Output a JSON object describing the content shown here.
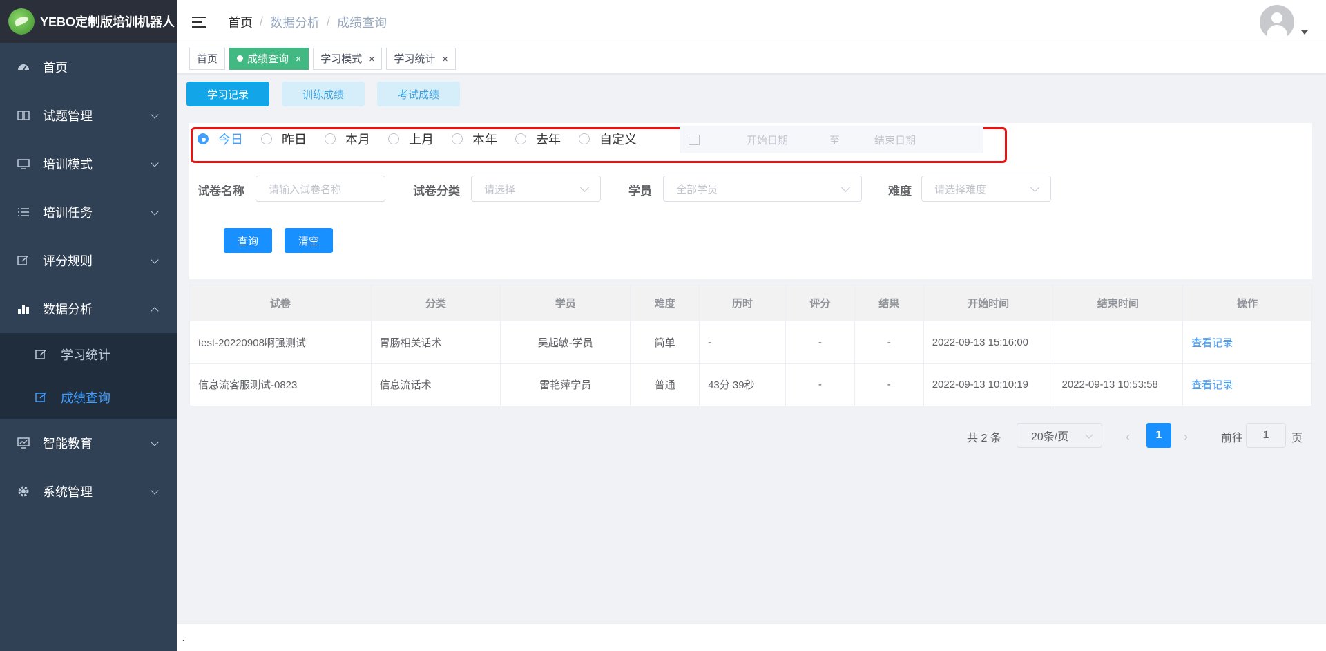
{
  "app": {
    "title": "YEBO定制版培训机器人"
  },
  "sidebar": {
    "items": [
      {
        "label": "首页",
        "icon": "dashboard-icon"
      },
      {
        "label": "试题管理",
        "icon": "book-icon"
      },
      {
        "label": "培训模式",
        "icon": "monitor-icon"
      },
      {
        "label": "培训任务",
        "icon": "list-icon"
      },
      {
        "label": "评分规则",
        "icon": "edit-icon"
      },
      {
        "label": "数据分析",
        "icon": "bar-chart-icon"
      },
      {
        "label": "智能教育",
        "icon": "chart-screen-icon"
      },
      {
        "label": "系统管理",
        "icon": "gear-icon"
      }
    ],
    "sub_items": [
      {
        "label": "学习统计",
        "icon": "edit-icon"
      },
      {
        "label": "成绩查询",
        "icon": "edit-icon"
      }
    ]
  },
  "header": {
    "breadcrumb": [
      "首页",
      "数据分析",
      "成绩查询"
    ]
  },
  "tags": [
    {
      "label": "首页"
    },
    {
      "label": "成绩查询",
      "close": "×"
    },
    {
      "label": "学习模式",
      "close": "×"
    },
    {
      "label": "学习统计",
      "close": "×"
    }
  ],
  "subtabs": [
    "学习记录",
    "训练成绩",
    "考试成绩"
  ],
  "filter": {
    "radios": [
      "今日",
      "昨日",
      "本月",
      "上月",
      "本年",
      "去年",
      "自定义"
    ],
    "date_start_placeholder": "开始日期",
    "date_to": "至",
    "date_end_placeholder": "结束日期",
    "fields": {
      "paper_name_label": "试卷名称",
      "paper_name_placeholder": "请输入试卷名称",
      "category_label": "试卷分类",
      "category_placeholder": "请选择",
      "student_label": "学员",
      "student_placeholder": "全部学员",
      "difficulty_label": "难度",
      "difficulty_placeholder": "请选择难度"
    },
    "query_button": "查询",
    "clear_button": "清空"
  },
  "table": {
    "headers": [
      "试卷",
      "分类",
      "学员",
      "难度",
      "历时",
      "评分",
      "结果",
      "开始时间",
      "结束时间",
      "操作"
    ],
    "rows": [
      [
        "test-20220908啊强测试",
        "胃肠相关话术",
        "吴起敏-学员",
        "简单",
        "-",
        "-",
        "-",
        "2022-09-13 15:16:00",
        "",
        "查看记录"
      ],
      [
        "信息流客服测试-0823",
        "信息流话术",
        "雷艳萍学员",
        "普通",
        "43分 39秒",
        "-",
        "-",
        "2022-09-13 10:10:19",
        "2022-09-13 10:53:58",
        "查看记录"
      ]
    ]
  },
  "pagination": {
    "total": "共 2 条",
    "page_size": "20条/页",
    "prev": "‹",
    "current": "1",
    "next": "›",
    "goto_label": "前往",
    "goto_value": "1",
    "goto_suffix": "页"
  },
  "footer": {
    "text": "."
  },
  "colors": {
    "sidebar_bg": "#304156",
    "active_tag": "#42b983",
    "primary": "#1890ff",
    "highlight_box": "#e81414"
  }
}
